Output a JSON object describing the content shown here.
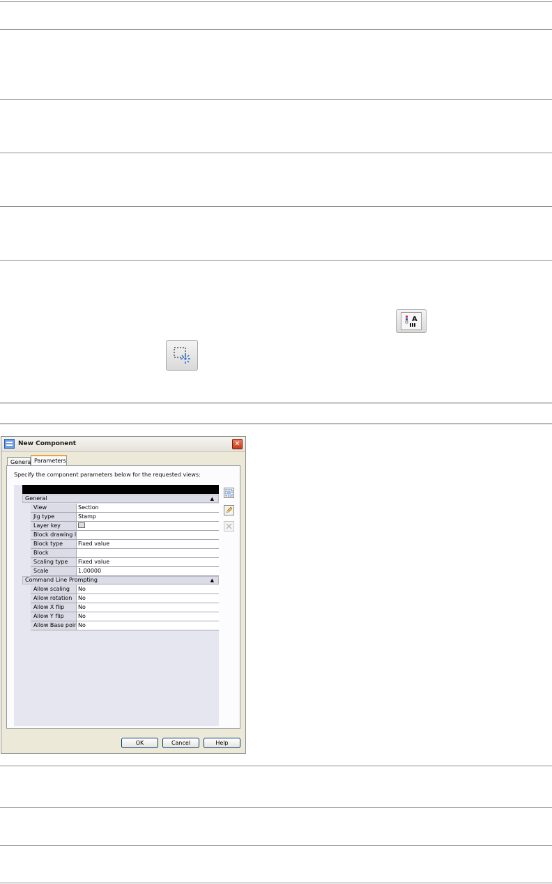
{
  "dialog": {
    "title": "New Component",
    "close_glyph": "✕",
    "tabs": [
      {
        "label": "General",
        "active": false
      },
      {
        "label": "Parameters",
        "active": true
      }
    ],
    "instruction": "Specify the component parameters below for the requested views:",
    "categories": {
      "general": {
        "label": "General",
        "arrow": "▲"
      },
      "prompting": {
        "label": "Command Line Prompting",
        "arrow": "▲"
      }
    },
    "general_rows": [
      {
        "name": "View",
        "value": "Section"
      },
      {
        "name": "Jig type",
        "value": "Stamp"
      },
      {
        "name": "Layer key",
        "value": "",
        "icon": "layer-key-icon"
      },
      {
        "name": "Block drawing l...",
        "value": ""
      },
      {
        "name": "Block type",
        "value": "Fixed value"
      },
      {
        "name": "Block",
        "value": ""
      },
      {
        "name": "Scaling type",
        "value": "Fixed value"
      },
      {
        "name": "Scale",
        "value": "1.00000"
      }
    ],
    "prompting_rows": [
      {
        "name": "Allow scaling",
        "value": "No"
      },
      {
        "name": "Allow rotation",
        "value": "No"
      },
      {
        "name": "Allow X flip",
        "value": "No"
      },
      {
        "name": "Allow Y flip",
        "value": "No"
      },
      {
        "name": "Allow Base point",
        "value": "No"
      }
    ],
    "side_buttons": [
      "add-view-icon",
      "edit-pencil-icon",
      "delete-x-icon"
    ],
    "buttons": {
      "ok": "OK",
      "cancel": "Cancel",
      "help": "Help"
    }
  },
  "toolbar_icons": [
    "layer-key-style-icon",
    "select-objects-icon"
  ],
  "colors": {
    "accent_tab": "#f0a33a",
    "title_close": "#c63a1c",
    "grid_bg": "#e5e6ef"
  }
}
